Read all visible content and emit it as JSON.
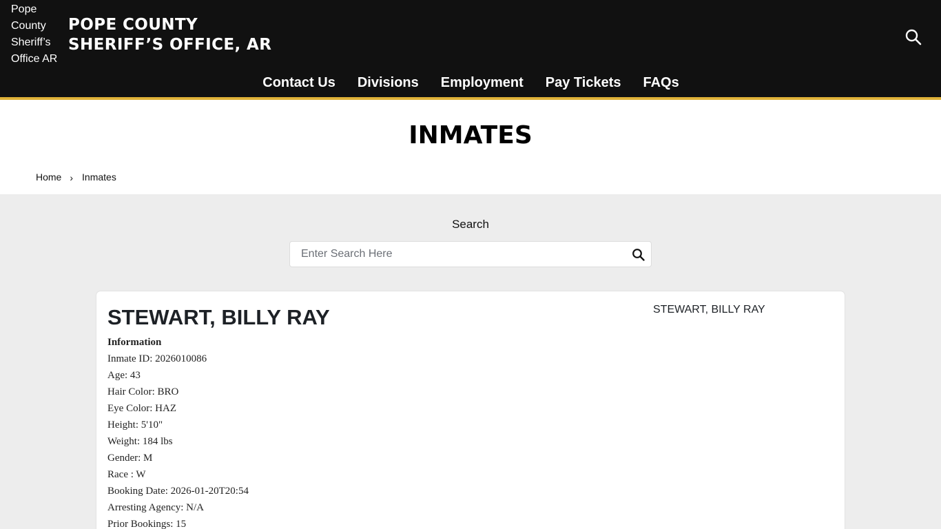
{
  "header": {
    "logo_alt": "Pope County Sheriff’s Office AR",
    "site_title_line1": "POPE COUNTY",
    "site_title_line2": "SHERIFF’S OFFICE, AR",
    "search_icon": "search-icon"
  },
  "nav": {
    "items": [
      "Contact Us",
      "Divisions",
      "Employment",
      "Pay Tickets",
      "FAQs"
    ]
  },
  "page": {
    "title": "INMATES"
  },
  "breadcrumb": {
    "home": "Home",
    "separator": "›",
    "current": "Inmates"
  },
  "search": {
    "label": "Search",
    "placeholder": "Enter Search Here",
    "value": "",
    "icon": "search-icon"
  },
  "inmate": {
    "name": "STEWART, BILLY RAY",
    "photo_alt": "STEWART, BILLY RAY",
    "info_heading": "Information",
    "fields": [
      "Inmate ID: 2026010086",
      "Age: 43",
      "Hair Color: BRO",
      "Eye Color: HAZ",
      "Height: 5'10\"",
      "Weight: 184 lbs",
      "Gender: M",
      "Race : W",
      "Booking Date: 2026-01-20T20:54",
      "Arresting Agency: N/A",
      "Prior Bookings: 15"
    ]
  },
  "colors": {
    "header_bg": "#111111",
    "accent_stripe": "#e0b238",
    "page_bg": "#ededed",
    "card_bg": "#ffffff"
  }
}
